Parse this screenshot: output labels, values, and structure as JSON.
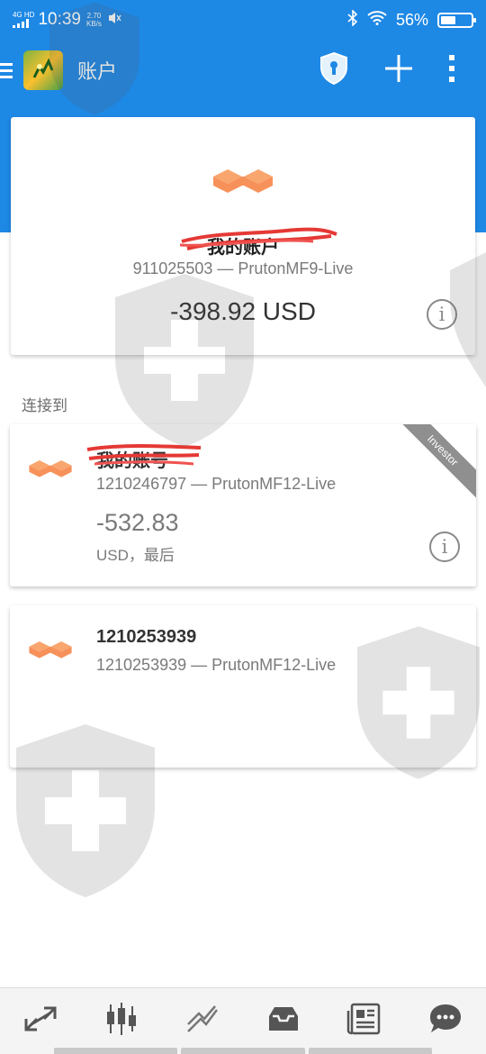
{
  "status_bar": {
    "network": "4G HD",
    "time": "10:39",
    "speed_value": "2.70",
    "speed_unit": "KB/s",
    "battery_percent_label": "56%",
    "battery_level": 0.56
  },
  "app_bar": {
    "title": "账户",
    "icons": [
      "menu-icon",
      "shield-icon",
      "add-icon",
      "more-vert-icon"
    ]
  },
  "current_account": {
    "name": "我的账户",
    "number_server": "911025503 — PrutonMF9-Live",
    "balance": "-398.92 USD"
  },
  "section_label": "连接到",
  "accounts": [
    {
      "name": "我的账号",
      "number_server": "1210246797 — PrutonMF12-Live",
      "balance": "-532.83",
      "balance_sub": "USD，最后",
      "badge": "Investor"
    },
    {
      "name": "1210253939",
      "number_server": "1210253939 — PrutonMF12-Live"
    }
  ],
  "bottom_nav": [
    "quotes-icon",
    "chart-icon",
    "trade-icon",
    "history-icon",
    "news-icon",
    "messages-icon"
  ],
  "colors": {
    "primary": "#1e88e5",
    "broker_logo": "#f7915a",
    "redaction": "#e53935"
  }
}
